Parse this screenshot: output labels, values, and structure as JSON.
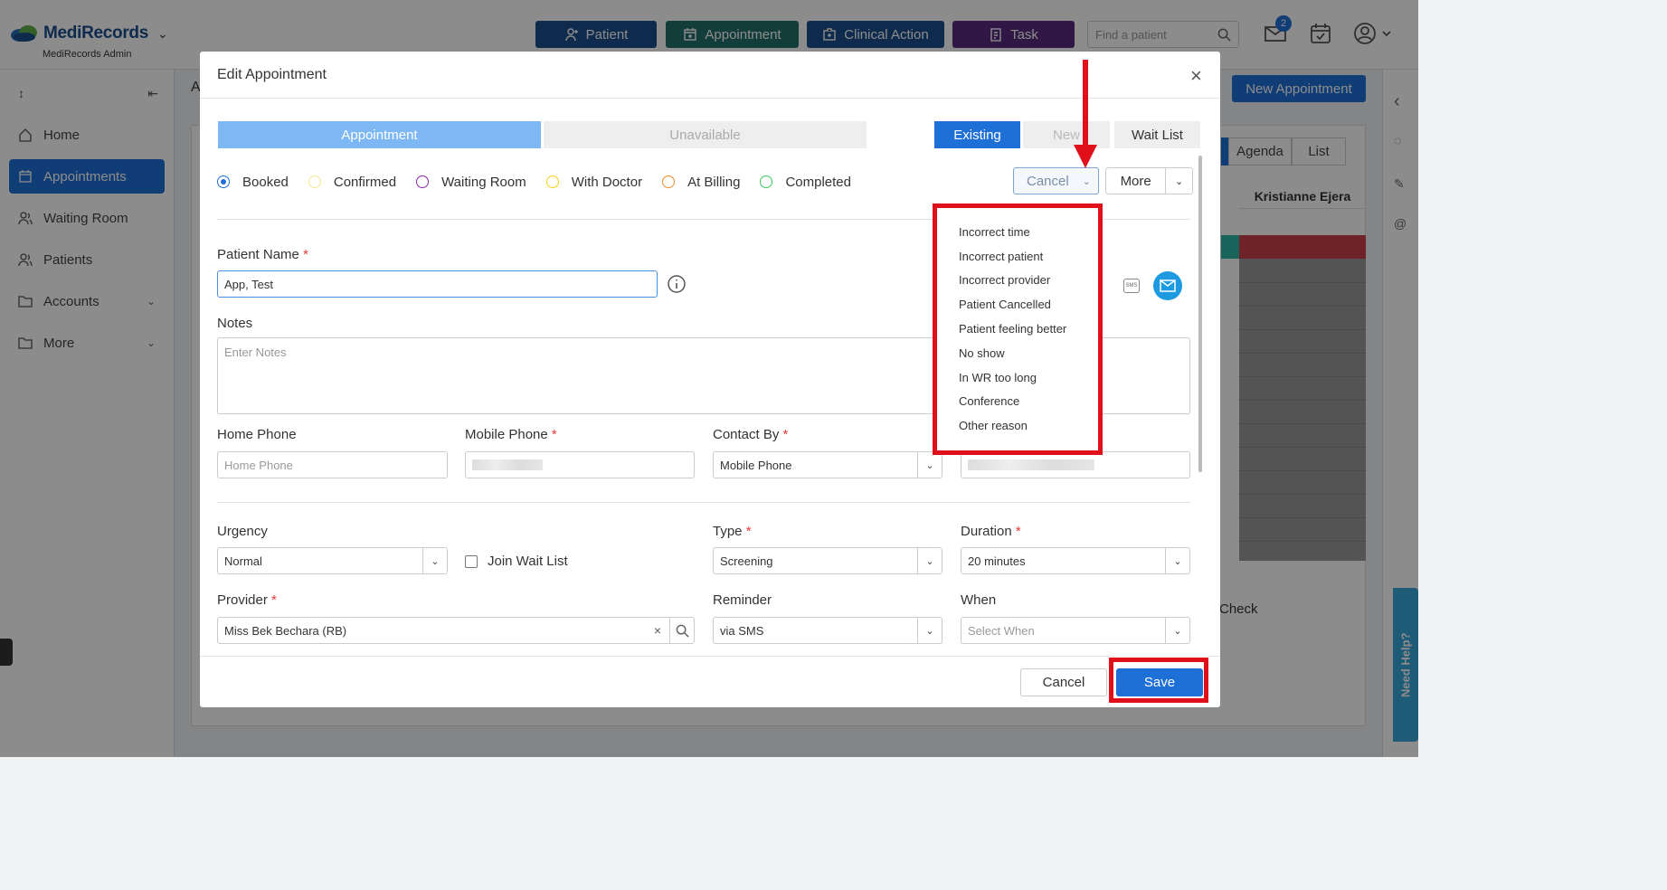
{
  "app": {
    "logo_text": "MediRecords",
    "logo_sub": "MediRecords Admin",
    "top_buttons": [
      {
        "label": "Patient",
        "color": "#1a4e8c"
      },
      {
        "label": "Appointment",
        "color": "#22706a"
      },
      {
        "label": "Clinical Action",
        "color": "#1a4e8c"
      },
      {
        "label": "Task",
        "color": "#5a2a80"
      }
    ],
    "search_placeholder": "Find a patient",
    "mail_badge": "2",
    "sidebar": [
      {
        "label": "Home",
        "icon": "home-icon"
      },
      {
        "label": "Appointments",
        "icon": "calendar-icon",
        "active": true
      },
      {
        "label": "Waiting Room",
        "icon": "users-icon"
      },
      {
        "label": "Patients",
        "icon": "users-icon"
      },
      {
        "label": "Accounts",
        "icon": "folder-icon"
      },
      {
        "label": "More",
        "icon": "folder-icon"
      }
    ],
    "new_appointment": "New Appointment",
    "view_tabs": [
      "Agenda",
      "List"
    ],
    "column_header": "Kristianne Ejera",
    "check_text": "Check",
    "need_help": "Need Help?",
    "partial_a": "A"
  },
  "modal": {
    "title": "Edit Appointment",
    "tabs": [
      "Appointment",
      "Unavailable"
    ],
    "mode_tabs": [
      "Existing",
      "New",
      "Wait List"
    ],
    "statuses": [
      {
        "label": "Booked",
        "color": "#1e6fd6",
        "selected": true
      },
      {
        "label": "Confirmed",
        "color": "#f3e98c"
      },
      {
        "label": "Waiting Room",
        "color": "#8e24aa"
      },
      {
        "label": "With Doctor",
        "color": "#f4d21a"
      },
      {
        "label": "At Billing",
        "color": "#f08a24"
      },
      {
        "label": "Completed",
        "color": "#3cc75a"
      }
    ],
    "cancel_dropdown": "Cancel",
    "more_dropdown": "More",
    "patient_name_label": "Patient Name",
    "patient_name_value": "App, Test",
    "notes_label": "Notes",
    "notes_placeholder": "Enter Notes",
    "home_phone_label": "Home Phone",
    "home_phone_placeholder": "Home Phone",
    "mobile_phone_label": "Mobile Phone",
    "contact_by_label": "Contact By",
    "contact_by_value": "Mobile Phone",
    "urgency_label": "Urgency",
    "urgency_value": "Normal",
    "join_wait_list": "Join Wait List",
    "type_label": "Type",
    "type_value": "Screening",
    "duration_label": "Duration",
    "duration_value": "20 minutes",
    "provider_label": "Provider",
    "provider_value": "Miss Bek Bechara (RB)",
    "reminder_label": "Reminder",
    "reminder_value": "via SMS",
    "when_label": "When",
    "when_placeholder": "Select When",
    "sms_icon_text": "SMS",
    "footer_cancel": "Cancel",
    "footer_save": "Save"
  },
  "cancel_reasons": [
    "Incorrect time",
    "Incorrect patient",
    "Incorrect provider",
    "Patient Cancelled",
    "Patient feeling better",
    "No show",
    "In WR too long",
    "Conference",
    "Other reason"
  ],
  "annotation_color": "#e0101a"
}
